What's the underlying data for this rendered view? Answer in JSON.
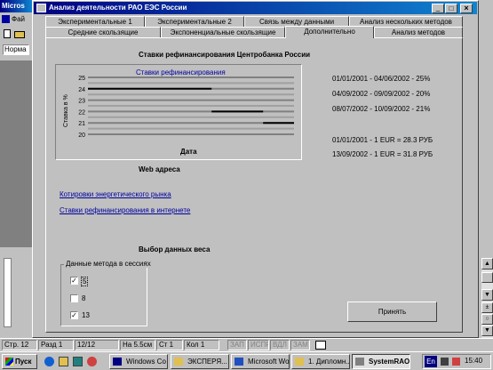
{
  "word": {
    "title": "Micros",
    "menu_label": "Фай",
    "style_field": "Норма",
    "sysbtn": "_",
    "scroll_up": "▲",
    "scroll_down": "▼",
    "prev_page": "±",
    "select_browse": "○",
    "next_page": "▼"
  },
  "dialog": {
    "title": "Анализ деятельности РАО ЕЭС России",
    "min_btn": "_",
    "max_btn": "□",
    "close_btn": "×",
    "tabs_back": [
      "Экспериментальные 1",
      "Экспериментальные 2",
      "Связь между данными",
      "Анализ нескольких методов"
    ],
    "tabs_front": [
      "Средние скользящие",
      "Экспоненциальные скользящие",
      "Дополнительно",
      "Анализ методов"
    ],
    "active_tab": "Дополнительно",
    "chart_title": "Ставки рефинансирования Центробанка России",
    "rates": [
      "01/01/2001 - 04/06/2002 - 25%",
      "04/09/2002 - 09/09/2002 - 20%",
      "08/07/2002 - 10/09/2002 - 21%"
    ],
    "exchange": [
      "01/01/2001 - 1 EUR = 28.3 РУБ",
      "13/09/2002 - 1 EUR = 31.8 РУБ"
    ],
    "web_label": "Web адреса",
    "links": [
      "Котировки энергетического рынка",
      "Ставки рефинансирования в интернете"
    ],
    "choice_label": "Выбор данных веса",
    "group_label": "Данные метода в сессиях",
    "checkboxes": [
      {
        "label": "5",
        "checked": true
      },
      {
        "label": "8",
        "checked": false
      },
      {
        "label": "13",
        "checked": true
      }
    ],
    "apply_label": "Принять",
    "check_mark": "✓"
  },
  "chart_data": {
    "type": "line",
    "title": "Ставки рефинансирования",
    "ylabel": "Ставка в %",
    "xlabel": "Дата",
    "ylim": [
      20,
      25
    ],
    "y_ticks": [
      "25",
      "24",
      "23",
      "22",
      "21",
      "20"
    ],
    "grid": true,
    "series": [
      {
        "x": [
          0,
          0.6
        ],
        "y": [
          24,
          24
        ]
      },
      {
        "x": [
          0.6,
          0.85
        ],
        "y": [
          22,
          22
        ]
      },
      {
        "x": [
          0.85,
          1
        ],
        "y": [
          21,
          21
        ]
      }
    ]
  },
  "statusbar": {
    "page": "Стр. 12",
    "section": "Разд 1",
    "pages": "12/12",
    "at": "На 5.5см",
    "line": "Ст 1",
    "col": "Кол 1",
    "modes": [
      "ЗАП",
      "ИСПР",
      "ВДЛ",
      "ЗАМ"
    ]
  },
  "taskbar": {
    "start": "Пуск",
    "items": [
      "Windows Co",
      "ЭКСПЕРЯ...",
      "Microsoft Wo...",
      "1. Дипломн...",
      "SystemRAO"
    ],
    "active": 4,
    "tray_lang": "En",
    "clock": "15:40"
  },
  "colors": {
    "title_start": "#000080",
    "title_end": "#1084d0",
    "face": "#c0c0c0",
    "link": "#0000a0",
    "desktop": "#808080"
  }
}
